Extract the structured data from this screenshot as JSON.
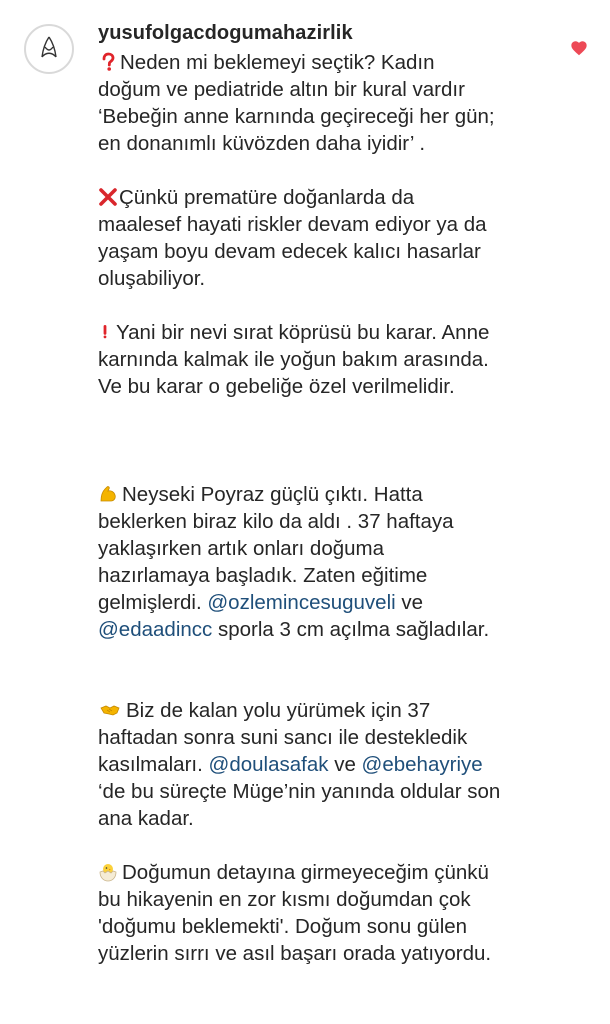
{
  "post": {
    "username": "yusufolgacdogumahazirlik",
    "liked": true,
    "accent_like_color": "#ed4956",
    "mention_color": "#1f4f7a"
  },
  "paragraphs": [
    {
      "icon": "red-question-mark-icon",
      "lines": [
        "Neden mi beklemeyi seçtik? Kadın",
        "doğum ve pediatride altın bir kural vardır",
        "‘Bebeğin anne karnında geçireceği her gün;",
        "en donanımlı küvözden daha iyidir’ ."
      ]
    },
    {
      "icon": "cross-mark-icon",
      "lines": [
        "Çünkü prematüre doğanlarda da",
        "maalesef hayati riskler devam ediyor ya da",
        "yaşam boyu devam edecek kalıcı hasarlar",
        "oluşabiliyor."
      ]
    },
    {
      "icon": "exclamation-mark-icon",
      "lines": [
        "Yani bir nevi sırat köprüsü bu karar. Anne",
        "karnında kalmak ile yoğun bakım arasında.",
        "Ve bu karar o gebeliğe özel verilmelidir."
      ]
    },
    {
      "icon": "flexed-biceps-icon",
      "lines": [
        "Neyseki Poyraz güçlü çıktı. Hatta",
        "beklerken biraz kilo da aldı . 37 haftaya",
        "yaklaşırken artık onları doğuma",
        "hazırlamaya başladık. Zaten eğitime"
      ],
      "line5_mention": "@ozlemincesuguveli",
      "line5_text": "gelmişlerdi.",
      "line5_after": "ve",
      "line6_mention": "@edaadincc",
      "line6_after": "sporla 3 cm açılma sağladılar."
    },
    {
      "icon": "handshake-icon",
      "lines": [
        "Biz de kalan yolu yürümek için 37",
        "haftadan sonra suni sancı ile destekledik"
      ],
      "line3_text": "kasılmaları.",
      "line3_mention1": "@doulasafak",
      "line3_mid": "ve",
      "line3_mention2": "@ebehayriye",
      "line4": "‘de bu süreçte Müge’nin yanında oldular son",
      "line5": "ana kadar."
    },
    {
      "icon": "hatching-chick-icon",
      "lines": [
        "Doğumun detayına girmeyeceğim çünkü",
        "bu hikayenin en zor kısmı doğumdan çok",
        "'doğumu beklemekti'. Doğum sonu gülen",
        "yüzlerin sırrı ve asıl başarı orada yatıyordu."
      ]
    }
  ]
}
